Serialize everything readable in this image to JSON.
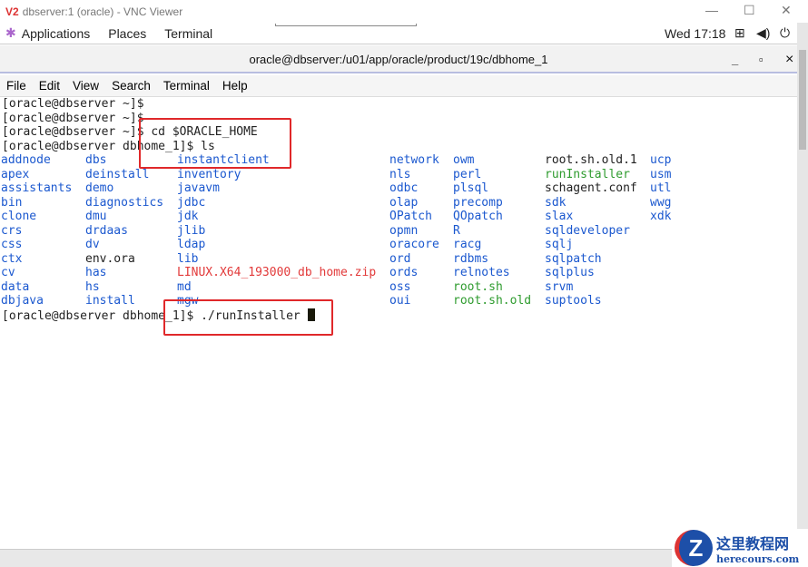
{
  "vnc": {
    "logo": "V2",
    "title": "dbserver:1 (oracle) - VNC Viewer",
    "minimize": "—",
    "maximize": "☐",
    "close": "✕"
  },
  "topbar": {
    "applications": "Applications",
    "places": "Places",
    "terminal": "Terminal",
    "clock": "Wed 17:18"
  },
  "window": {
    "title": "oracle@dbserver:/u01/app/oracle/product/19c/dbhome_1",
    "min": "_",
    "max": "▫",
    "close": "×"
  },
  "menu": [
    "File",
    "Edit",
    "View",
    "Search",
    "Terminal",
    "Help"
  ],
  "lines": [
    "[oracle@dbserver ~]$",
    "[oracle@dbserver ~]$",
    "[oracle@dbserver ~]$ cd $ORACLE_HOME",
    "[oracle@dbserver dbhome_1]$ ls"
  ],
  "prompt": "[oracle@dbserver dbhome_1]$ ./runInstaller ",
  "listing": [
    [
      [
        "addnode",
        "dir"
      ],
      [
        "apex",
        "dir"
      ],
      [
        "assistants",
        "dir"
      ],
      [
        "bin",
        "dir"
      ],
      [
        "clone",
        "dir"
      ],
      [
        "crs",
        "dir"
      ],
      [
        "css",
        "dir"
      ],
      [
        "ctx",
        "dir"
      ],
      [
        "cv",
        "dir"
      ],
      [
        "data",
        "dir"
      ],
      [
        "dbjava",
        "dir"
      ]
    ],
    [
      [
        "dbs",
        "dir"
      ],
      [
        "deinstall",
        "dir"
      ],
      [
        "demo",
        "dir"
      ],
      [
        "diagnostics",
        "dir"
      ],
      [
        "dmu",
        "dir"
      ],
      [
        "drdaas",
        "dir"
      ],
      [
        "dv",
        "dir"
      ],
      [
        "env.ora",
        "file"
      ],
      [
        "has",
        "dir"
      ],
      [
        "hs",
        "dir"
      ],
      [
        "install",
        "dir"
      ]
    ],
    [
      [
        "instantclient",
        "dir"
      ],
      [
        "inventory",
        "dir"
      ],
      [
        "javavm",
        "dir"
      ],
      [
        "jdbc",
        "dir"
      ],
      [
        "jdk",
        "dir"
      ],
      [
        "jlib",
        "dir"
      ],
      [
        "ldap",
        "dir"
      ],
      [
        "lib",
        "dir"
      ],
      [
        "LINUX.X64_193000_db_home.zip",
        "arc"
      ],
      [
        "md",
        "dir"
      ],
      [
        "mgw",
        "dir"
      ]
    ],
    [
      [
        "network",
        "dir"
      ],
      [
        "nls",
        "dir"
      ],
      [
        "odbc",
        "dir"
      ],
      [
        "olap",
        "dir"
      ],
      [
        "OPatch",
        "dir"
      ],
      [
        "opmn",
        "dir"
      ],
      [
        "oracore",
        "dir"
      ],
      [
        "ord",
        "dir"
      ],
      [
        "ords",
        "dir"
      ],
      [
        "oss",
        "dir"
      ],
      [
        "oui",
        "dir"
      ]
    ],
    [
      [
        "owm",
        "dir"
      ],
      [
        "perl",
        "dir"
      ],
      [
        "plsql",
        "dir"
      ],
      [
        "precomp",
        "dir"
      ],
      [
        "QOpatch",
        "dir"
      ],
      [
        "R",
        "dir"
      ],
      [
        "racg",
        "dir"
      ],
      [
        "rdbms",
        "dir"
      ],
      [
        "relnotes",
        "dir"
      ],
      [
        "root.sh",
        "exe"
      ],
      [
        "root.sh.old",
        "exe"
      ]
    ],
    [
      [
        "root.sh.old.1",
        "file"
      ],
      [
        "runInstaller",
        "exe"
      ],
      [
        "schagent.conf",
        "file"
      ],
      [
        "sdk",
        "dir"
      ],
      [
        "slax",
        "dir"
      ],
      [
        "sqldeveloper",
        "dir"
      ],
      [
        "sqlj",
        "dir"
      ],
      [
        "sqlpatch",
        "dir"
      ],
      [
        "sqlplus",
        "dir"
      ],
      [
        "srvm",
        "dir"
      ],
      [
        "suptools",
        "dir"
      ]
    ],
    [
      [
        "ucp",
        "dir"
      ],
      [
        "usm",
        "dir"
      ],
      [
        "utl",
        "dir"
      ],
      [
        "wwg",
        "dir"
      ],
      [
        "xdk",
        "dir"
      ]
    ]
  ],
  "watermark": {
    "cn": "这里教程网",
    "en": "herecours.com",
    "logo": "Z"
  }
}
